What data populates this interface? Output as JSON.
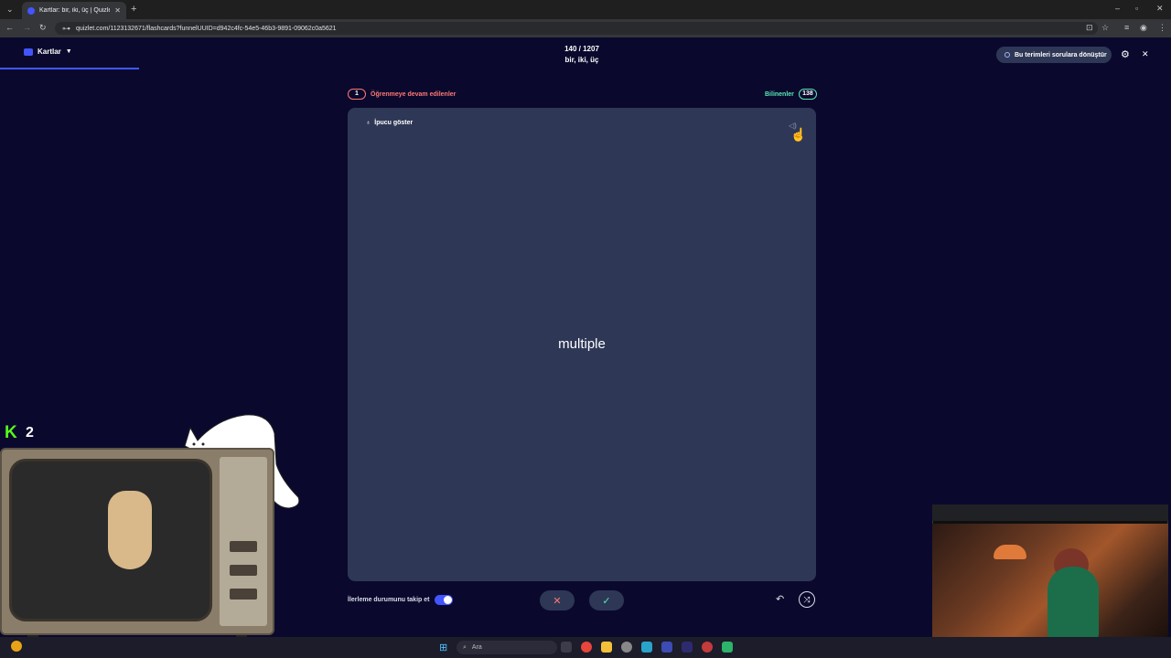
{
  "browser": {
    "tab_title": "Kartlar: bir, iki, üç | Quizlet",
    "url": "quizlet.com/1123132671/flashcards?funnelUUID=d942c4fc-54e5-46b3-9891-09062c0a5621"
  },
  "header": {
    "mode_label": "Kartlar",
    "progress": "140 / 1207",
    "set_title": "bir, iki, üç",
    "convert_button": "Bu terimleri sorulara dönüştür"
  },
  "counts": {
    "learning_count": "1",
    "learning_label": "Öğrenmeye devam edilenler",
    "known_label": "Bilinenler",
    "known_count": "138"
  },
  "card": {
    "hint_label": "İpucu göster",
    "term": "multiple"
  },
  "controls": {
    "track_progress_label": "İlerleme durumunu takip et",
    "track_progress_enabled": true
  },
  "overlay": {
    "kick_count": "2"
  },
  "taskbar": {
    "search_placeholder": "Ara"
  },
  "colors": {
    "background": "#0a092d",
    "card": "#2e3856",
    "accent": "#4255ff",
    "learning": "#ff7873",
    "known": "#59e8b5"
  }
}
